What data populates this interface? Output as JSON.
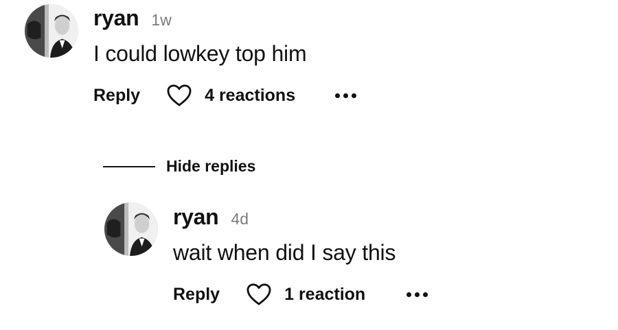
{
  "comments": [
    {
      "username": "ryan",
      "timestamp": "1w",
      "text": "I could lowkey top him",
      "reply_label": "Reply",
      "reactions_label": "4 reactions"
    },
    {
      "username": "ryan",
      "timestamp": "4d",
      "text": "wait when did I say this",
      "reply_label": "Reply",
      "reactions_label": "1 reaction"
    }
  ],
  "replies_toggle": {
    "label": "Hide replies"
  },
  "icons": {
    "like": "heart-outline-icon",
    "more": "more-horizontal-icon"
  }
}
